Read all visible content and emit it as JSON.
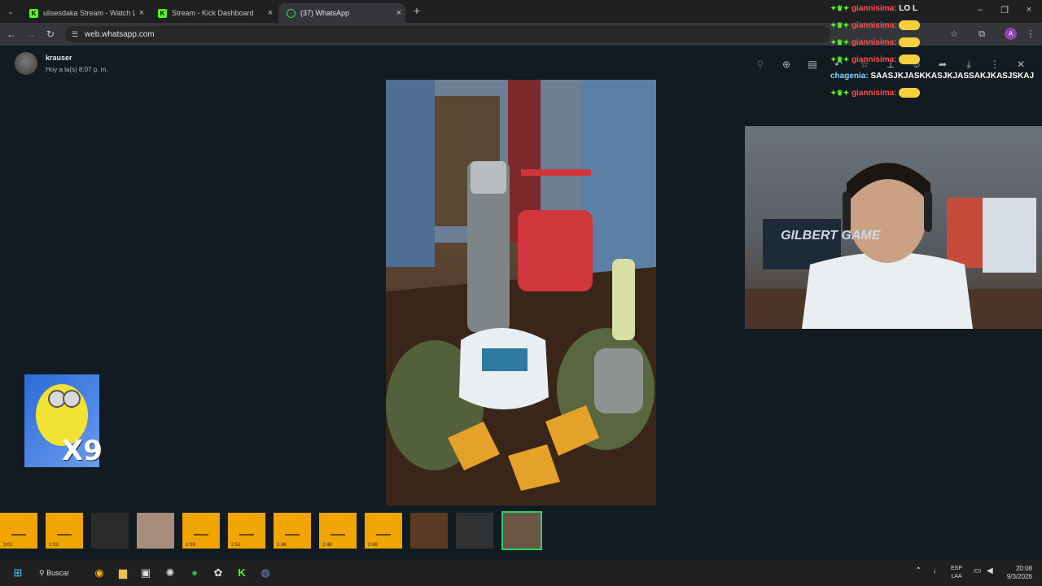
{
  "browser": {
    "tabs": [
      {
        "label": "ulisesdaka Stream - Watch Live",
        "icon": "kick-icon",
        "active": false
      },
      {
        "label": "Stream - Kick Dashboard",
        "icon": "kick-icon",
        "active": false
      },
      {
        "label": "(37) WhatsApp",
        "icon": "whatsapp-icon",
        "active": true
      }
    ],
    "url": "web.whatsapp.com"
  },
  "viewer": {
    "sender_name": "krauser",
    "sender_time": "Hoy a la(s) 8:07 p. m.",
    "sticker_text": "X9",
    "thumbnails": [
      {
        "type": "audio",
        "label": "3:01"
      },
      {
        "type": "audio",
        "label": "1:33"
      },
      {
        "type": "image",
        "label": ""
      },
      {
        "type": "image",
        "label": ""
      },
      {
        "type": "audio",
        "label": "1:09"
      },
      {
        "type": "audio",
        "label": "2:51"
      },
      {
        "type": "audio",
        "label": "2:48"
      },
      {
        "type": "audio",
        "label": "2:48"
      },
      {
        "type": "audio",
        "label": "2:48"
      },
      {
        "type": "image",
        "label": ""
      },
      {
        "type": "image",
        "label": ""
      },
      {
        "type": "image",
        "label": "",
        "selected": true
      }
    ]
  },
  "chat_overlay": {
    "messages": [
      {
        "user": "giannisima:",
        "text": "LO L"
      },
      {
        "user": "giannisima:",
        "text": ""
      },
      {
        "user": "giannisima:",
        "text": ""
      },
      {
        "user": "giannisima:",
        "text": ""
      },
      {
        "user": "chagenia:",
        "text": "SAASJKJASKKASJKJASSAKJKASJSKAJ"
      },
      {
        "user": "giannisima:",
        "text": ""
      }
    ]
  },
  "webcam": {
    "logo_text": "GILBERT GAME"
  },
  "taskbar": {
    "search_label": "Buscar",
    "lang_line1": "ESP",
    "lang_line2": "LAA",
    "time": "20:08",
    "date": "9/3/2026"
  },
  "colors": {
    "accent": "#25d366",
    "kick": "#53fc18",
    "chat_user": "#ff4d4d"
  }
}
